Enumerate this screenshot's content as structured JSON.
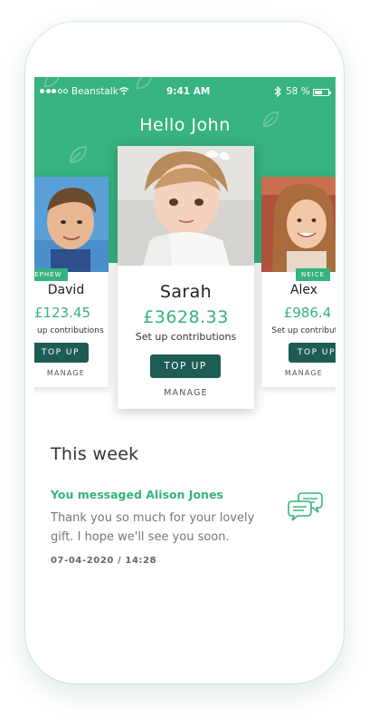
{
  "status_bar": {
    "carrier": "Beanstalk",
    "time": "9:41 AM",
    "battery": "58 %",
    "battery_level": 0.58
  },
  "header": {
    "greeting": "Hello John"
  },
  "children": {
    "left": {
      "badge": "NEPHEW",
      "name": "David",
      "amount": "£123.45",
      "contributions": "Set up contributions",
      "top_up": "TOP UP",
      "manage": "MANAGE"
    },
    "center": {
      "name": "Sarah",
      "amount": "£3628.33",
      "contributions": "Set up contributions",
      "top_up": "TOP UP",
      "manage": "MANAGE"
    },
    "right": {
      "badge": "NEICE",
      "name": "Alex",
      "amount": "£986.4",
      "contributions": "Set up contributions",
      "top_up": "TOP UP",
      "manage": "MANAGE"
    }
  },
  "this_week": {
    "title": "This week",
    "message_title": "You messaged Alison Jones",
    "message_body": "Thank you so much for your lovely gift. I hope we'll see you soon.",
    "timestamp": "07-04-2020 / 14:28"
  },
  "colors": {
    "brand_green": "#36b37e",
    "button_dark": "#1d5c55"
  },
  "icons": [
    "wifi-icon",
    "bluetooth-icon",
    "battery-icon",
    "leaf-icon",
    "chat-bubbles-icon"
  ]
}
